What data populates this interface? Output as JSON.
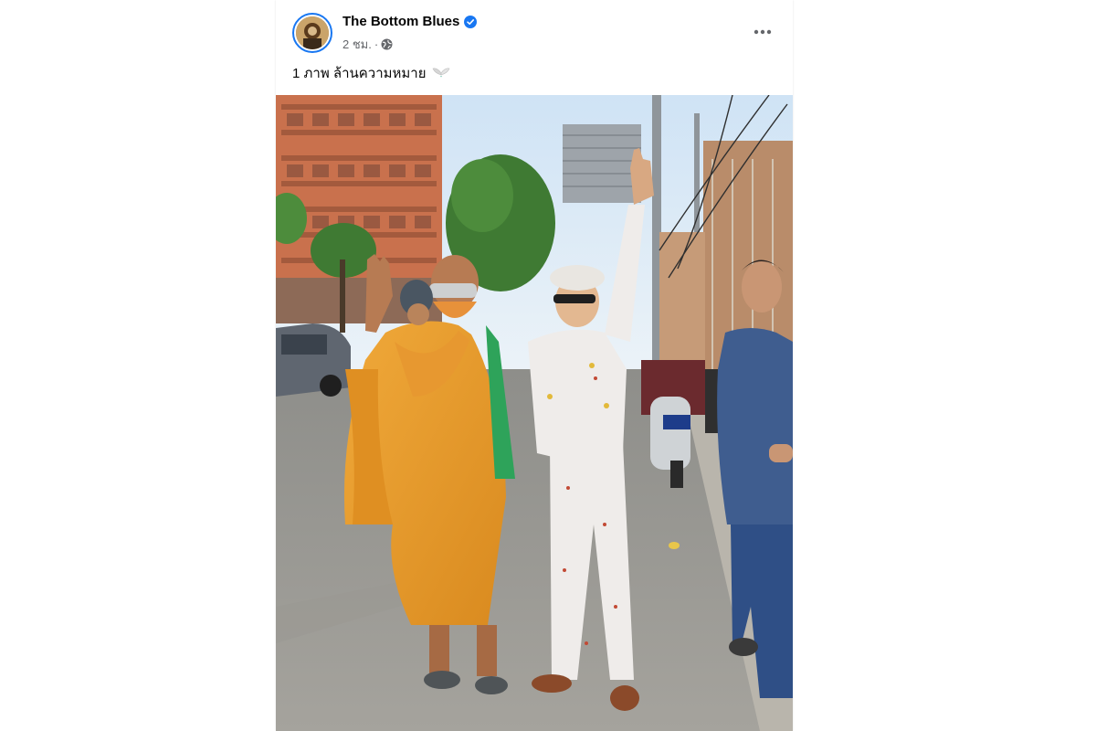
{
  "post": {
    "page_name": "The Bottom Blues",
    "verified_icon": "verified-badge-icon",
    "timestamp": "2 ชม.",
    "separator": "·",
    "privacy_icon": "globe-icon",
    "more_icon": "more-options-icon",
    "caption_text": "1 ภาพ ล้านความหมาย",
    "caption_emoji_icon": "wings-emoji-icon"
  },
  "colors": {
    "accent": "#1877f2",
    "text_primary": "#050505",
    "text_secondary": "#65676b"
  }
}
